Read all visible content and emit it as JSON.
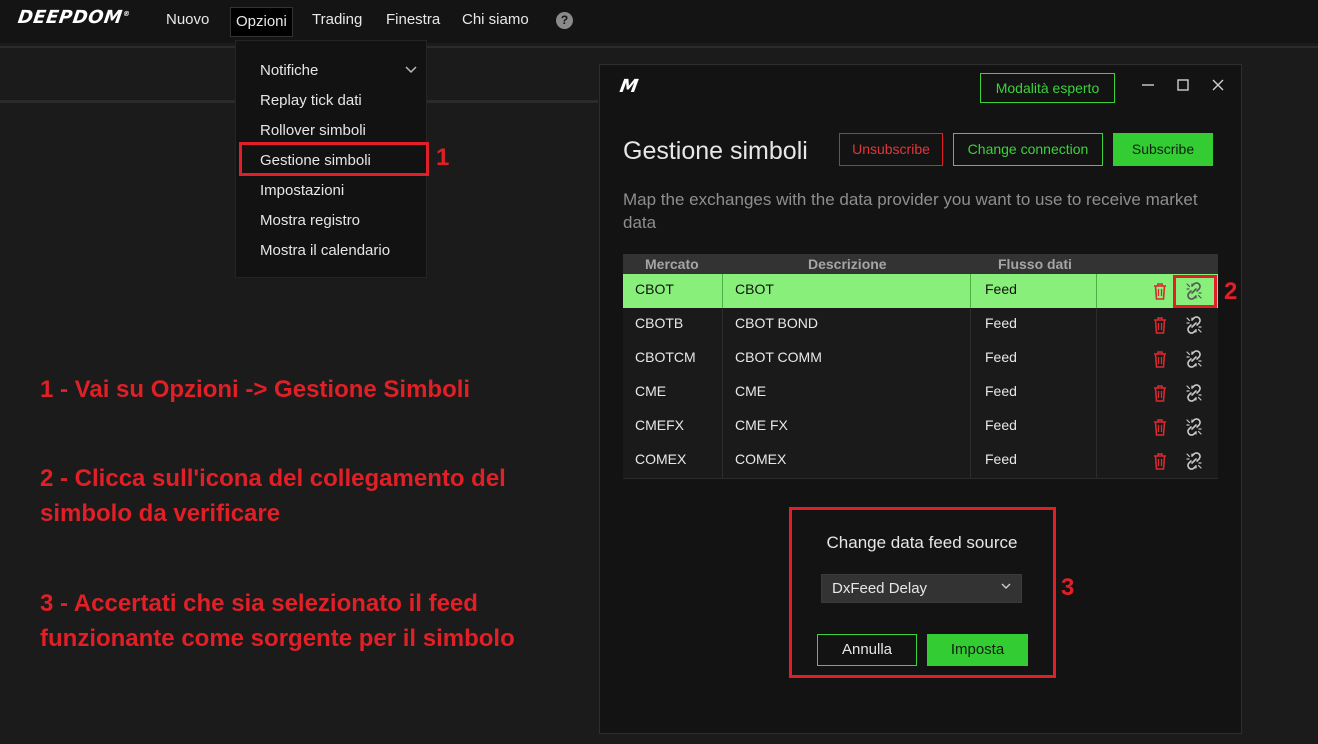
{
  "topbar": {
    "logo": "DEEPDOM",
    "logo_mark": "®",
    "menu": [
      "Nuovo",
      "Opzioni",
      "Trading",
      "Finestra",
      "Chi siamo"
    ],
    "help_icon": "question-circle-icon"
  },
  "dropdown": {
    "items": [
      "Notifiche",
      "Replay tick dati",
      "Rollover simboli",
      "Gestione simboli",
      "Impostazioni",
      "Mostra registro",
      "Mostra il calendario"
    ],
    "chevron_icon": "chevron-down-icon"
  },
  "annotations": {
    "num1": "1",
    "num2": "2",
    "num3": "3",
    "step1": "1 - Vai su Opzioni -> Gestione Simboli",
    "step2": "2 - Clicca sull'icona del collegamento del simbolo da verificare",
    "step3": "3 - Accertati che sia selezionato il feed funzionante come sorgente per il simbolo",
    "highlight_color": "#e01f26"
  },
  "window": {
    "logo": "M",
    "expert_label": "Modalità esperto",
    "controls": [
      "minimize-icon",
      "maximize-icon",
      "close-icon"
    ],
    "title": "Gestione simboli",
    "unsubscribe_label": "Unsubscribe",
    "change_connection_label": "Change connection",
    "subscribe_label": "Subscribe",
    "description": "Map the exchanges with the data provider you want to use to receive market data",
    "accent_color": "#3cd23c",
    "selected_row_color": "#88f07a"
  },
  "table": {
    "headers": [
      "Mercato",
      "Descrizione",
      "Flusso dati"
    ],
    "rows": [
      {
        "mercato": "CBOT",
        "descrizione": "CBOT",
        "flusso": "Feed",
        "selected": true
      },
      {
        "mercato": "CBOTB",
        "descrizione": "CBOT BOND",
        "flusso": "Feed"
      },
      {
        "mercato": "CBOTCM",
        "descrizione": "CBOT COMM",
        "flusso": "Feed"
      },
      {
        "mercato": "CME",
        "descrizione": "CME",
        "flusso": "Feed"
      },
      {
        "mercato": "CMEFX",
        "descrizione": "CME FX",
        "flusso": "Feed"
      },
      {
        "mercato": "COMEX",
        "descrizione": "COMEX",
        "flusso": "Feed"
      }
    ],
    "row_icons": [
      "trash-icon",
      "link-icon"
    ]
  },
  "dialog": {
    "title": "Change data feed source",
    "selected_feed": "DxFeed Delay",
    "cancel_label": "Annulla",
    "set_label": "Imposta"
  }
}
